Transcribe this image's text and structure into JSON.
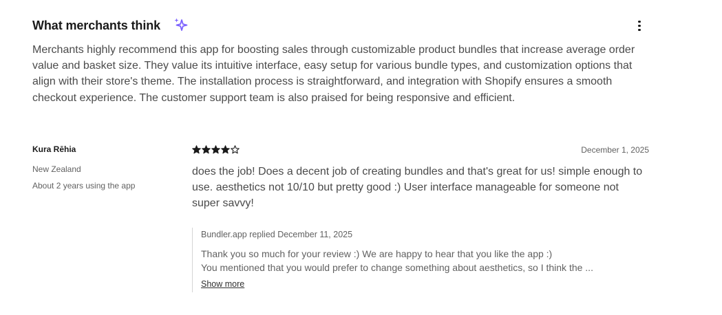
{
  "section": {
    "title": "What merchants think",
    "sparkle_icon": "sparkle-icon",
    "menu_icon": "more-vertical-icon",
    "summary": "Merchants highly recommend this app for boosting sales through customizable product bundles that increase average order value and basket size. They value its intuitive interface, easy setup for various bundle types, and customization options that align with their store's theme. The installation process is straightforward, and integration with Shopify ensures a smooth checkout experience. The customer support team is also praised for being responsive and efficient."
  },
  "review": {
    "reviewer_name": "Kura Rēhia",
    "country": "New Zealand",
    "usage": "About 2 years using the app",
    "rating": 4,
    "rating_max": 5,
    "date": "December 1, 2025",
    "text": "does the job! Does a decent job of creating bundles and that's great for us! simple enough to use. aesthetics not 10/10 but pretty good :) User interface manageable for someone not super savvy!",
    "reply": {
      "header": "Bundler.app replied December 11, 2025",
      "line1": "Thank you so much for your review :) We are happy to hear that you like the app :)",
      "line2": "You mentioned that you would prefer to change something about aesthetics, so I think the ...",
      "show_more_label": "Show more"
    }
  },
  "colors": {
    "accent": "#7b61ff",
    "text_primary": "#1a1a1a",
    "text_secondary": "#616161",
    "star": "#1a1a1a"
  }
}
